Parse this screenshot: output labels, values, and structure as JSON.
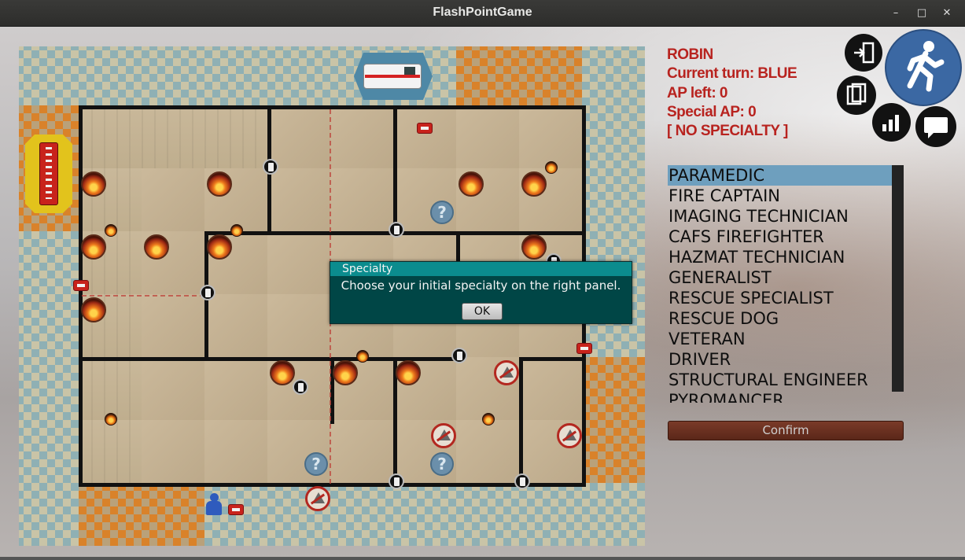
{
  "window": {
    "title": "FlashPointGame",
    "controls": [
      "minimize-icon",
      "maximize-icon",
      "close-icon"
    ]
  },
  "player": {
    "name": "ROBIN",
    "current_turn": "Current turn: BLUE",
    "ap_left": "AP left: 0",
    "special_ap": "Special AP: 0",
    "specialty": "[ NO SPECIALTY ]"
  },
  "icons": {
    "exit": "exit-door-icon",
    "card": "card-icon",
    "stats": "bar-chart-icon",
    "chat": "chat-bubble-icon",
    "running": "running-man-icon"
  },
  "specialties": {
    "items": [
      {
        "label": "PARAMEDIC",
        "selected": true
      },
      {
        "label": "FIRE CAPTAIN"
      },
      {
        "label": "IMAGING TECHNICIAN"
      },
      {
        "label": "CAFS FIREFIGHTER"
      },
      {
        "label": "HAZMAT TECHNICIAN"
      },
      {
        "label": "GENERALIST"
      },
      {
        "label": "RESCUE SPECIALIST"
      },
      {
        "label": "RESCUE DOG"
      },
      {
        "label": "VETERAN"
      },
      {
        "label": "DRIVER"
      },
      {
        "label": "STRUCTURAL ENGINEER"
      },
      {
        "label": "PYROMANCER"
      }
    ],
    "confirm_label": "Confirm"
  },
  "dialog": {
    "title": "Specialty",
    "message": "Choose your initial specialty on the right panel.",
    "ok_label": "OK"
  },
  "board": {
    "poi_label": "?",
    "colors": {
      "wall": "#111111",
      "fire": "#ee7a1c",
      "poi": "#6b8faa",
      "player_pawn": "#2f5bbd"
    }
  }
}
